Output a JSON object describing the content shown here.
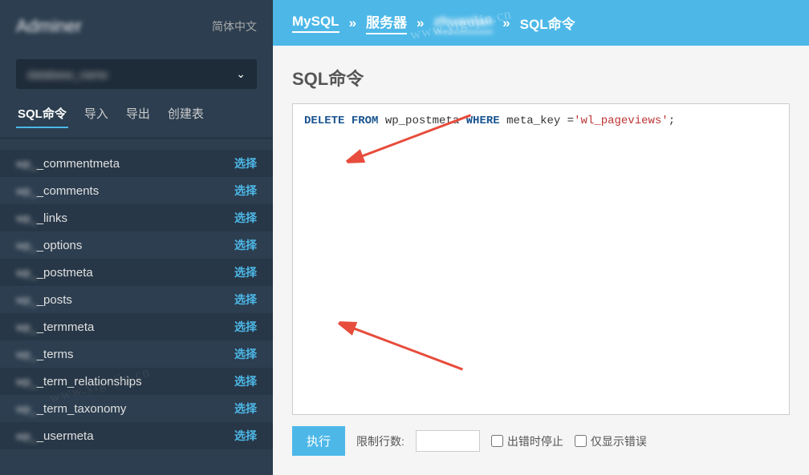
{
  "logo": "Adminer",
  "language": "简体中文",
  "db_selected": "database_name",
  "sidebar_tabs": {
    "sql": "SQL命令",
    "import": "导入",
    "export": "导出",
    "create": "创建表"
  },
  "tables": [
    {
      "prefix": "wp_",
      "name": "_commentmeta",
      "action": "选择"
    },
    {
      "prefix": "wp_",
      "name": "_comments",
      "action": "选择"
    },
    {
      "prefix": "wp_",
      "name": "_links",
      "action": "选择"
    },
    {
      "prefix": "wp_",
      "name": "_options",
      "action": "选择"
    },
    {
      "prefix": "wp_",
      "name": "_postmeta",
      "action": "选择"
    },
    {
      "prefix": "wp_",
      "name": "_posts",
      "action": "选择"
    },
    {
      "prefix": "wp_",
      "name": "_termmeta",
      "action": "选择"
    },
    {
      "prefix": "wp_",
      "name": "_terms",
      "action": "选择"
    },
    {
      "prefix": "wp_",
      "name": "_term_relationships",
      "action": "选择"
    },
    {
      "prefix": "wp_",
      "name": "_term_taxonomy",
      "action": "选择"
    },
    {
      "prefix": "wp_",
      "name": "_usermeta",
      "action": "选择"
    }
  ],
  "breadcrumb": {
    "engine": "MySQL",
    "server": "服务器",
    "db": "zhuanlan",
    "current": "SQL命令",
    "sep": "»"
  },
  "page_title": "SQL命令",
  "sql": {
    "kw1": "DELETE",
    "kw2": "FROM",
    "part1": " wp_postmeta ",
    "kw3": "WHERE",
    "part2": " meta_key =",
    "str": "'wl_pageviews'",
    "part3": ";"
  },
  "actions": {
    "execute": "执行",
    "limit_label": "限制行数:",
    "limit_value": "",
    "stop_on_error": "出错时停止",
    "only_errors": "仅显示错误"
  },
  "watermark": "www.yigujin.cn"
}
